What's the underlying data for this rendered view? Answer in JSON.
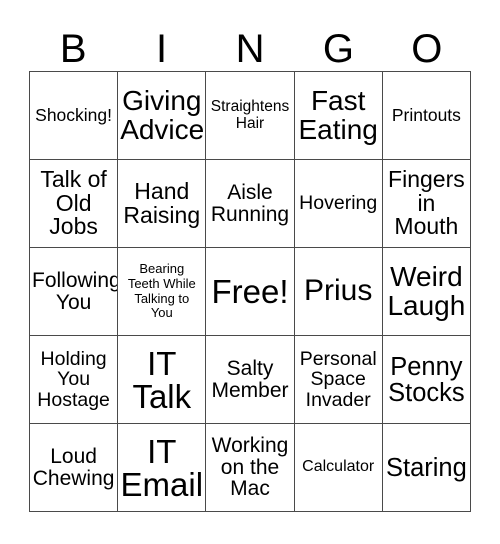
{
  "card": {
    "title": "BINGO",
    "header_letters": [
      "B",
      "I",
      "N",
      "G",
      "O"
    ],
    "grid_size": "5x5",
    "free_space_label": "Free!",
    "colors": {
      "background": "#ffffff",
      "text": "#000000",
      "grid_line": "#4a4a4a"
    },
    "rows": [
      {
        "cells": [
          {
            "text": "Shocking!",
            "size": "fs-17",
            "free": false
          },
          {
            "text": "Giving\nAdvice",
            "size": "fs-28",
            "free": false
          },
          {
            "text": "Straightens\nHair",
            "size": "fs-15",
            "free": false
          },
          {
            "text": "Fast\nEating",
            "size": "fs-28",
            "free": false
          },
          {
            "text": "Printouts",
            "size": "fs-17",
            "free": false
          }
        ]
      },
      {
        "cells": [
          {
            "text": "Talk of\nOld\nJobs",
            "size": "fs-23",
            "free": false
          },
          {
            "text": "Hand\nRaising",
            "size": "fs-23",
            "free": false
          },
          {
            "text": "Aisle\nRunning",
            "size": "fs-21",
            "free": false
          },
          {
            "text": "Hovering",
            "size": "fs-19",
            "free": false
          },
          {
            "text": "Fingers\nin\nMouth",
            "size": "fs-23",
            "free": false
          }
        ]
      },
      {
        "cells": [
          {
            "text": "Following\nYou",
            "size": "fs-21",
            "free": false
          },
          {
            "text": "Bearing\nTeeth While\nTalking to\nYou",
            "size": "fs-13",
            "free": false
          },
          {
            "text": "Free!",
            "size": "fs-33",
            "free": true
          },
          {
            "text": "Prius",
            "size": "fs-30",
            "free": false
          },
          {
            "text": "Weird\nLaugh",
            "size": "fs-28",
            "free": false
          }
        ]
      },
      {
        "cells": [
          {
            "text": "Holding\nYou\nHostage",
            "size": "fs-19",
            "free": false
          },
          {
            "text": "IT\nTalk",
            "size": "fs-33",
            "free": false
          },
          {
            "text": "Salty\nMember",
            "size": "fs-21",
            "free": false
          },
          {
            "text": "Personal\nSpace\nInvader",
            "size": "fs-19",
            "free": false
          },
          {
            "text": "Penny\nStocks",
            "size": "fs-25",
            "free": false
          }
        ]
      },
      {
        "cells": [
          {
            "text": "Loud\nChewing",
            "size": "fs-21",
            "free": false
          },
          {
            "text": "IT\nEmail",
            "size": "fs-33",
            "free": false
          },
          {
            "text": "Working\non the\nMac",
            "size": "fs-21",
            "free": false
          },
          {
            "text": "Calculator",
            "size": "fs-16",
            "free": false
          },
          {
            "text": "Staring",
            "size": "fs-25",
            "free": false
          }
        ]
      }
    ]
  }
}
